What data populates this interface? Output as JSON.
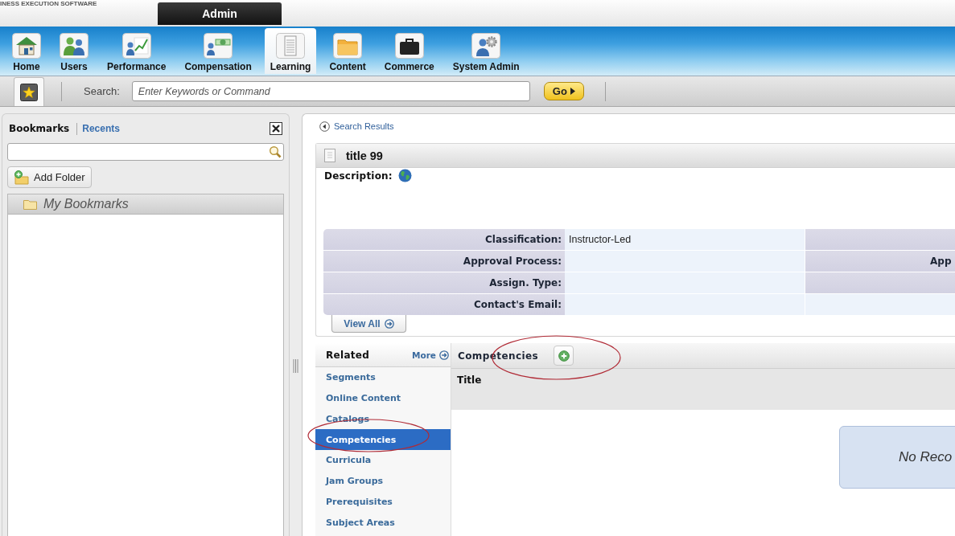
{
  "header": {
    "logo_text": "INESS EXECUTION SOFTWARE",
    "tabs": [
      {
        "label": "Admin",
        "selected": true
      }
    ]
  },
  "nav_bar": {
    "items": [
      {
        "label": "Home",
        "selected": false
      },
      {
        "label": "Users",
        "selected": false
      },
      {
        "label": "Performance",
        "selected": false
      },
      {
        "label": "Compensation",
        "selected": false
      },
      {
        "label": "Learning",
        "selected": true
      },
      {
        "label": "Content",
        "selected": false
      },
      {
        "label": "Commerce",
        "selected": false
      },
      {
        "label": "System Admin",
        "selected": false
      }
    ]
  },
  "search_bar": {
    "label": "Search:",
    "placeholder": "Enter Keywords or Command",
    "go_button": "Go"
  },
  "bookmarks_panel": {
    "tabs": [
      {
        "label": "Bookmarks",
        "selected": true
      },
      {
        "label": "Recents",
        "selected": false
      }
    ],
    "add_folder_button": "Add Folder",
    "tree": [
      {
        "label": "My Bookmarks"
      }
    ]
  },
  "record": {
    "back_link": "Search Results",
    "title": "title 99",
    "description_label": "Description:",
    "properties": [
      {
        "kind": "double",
        "label": "Classification:",
        "value": "Instructor-Led"
      },
      {
        "kind": "double",
        "label": "Approval Process:",
        "label_2": "App"
      },
      {
        "kind": "double",
        "label": "Assign. Type:"
      },
      {
        "kind": "single",
        "label": "Contact's Email:"
      }
    ],
    "view_all_button": "View All"
  },
  "related": {
    "title": "Related",
    "more_link": "More",
    "items": [
      {
        "label": "Segments",
        "selected": false,
        "circled": false
      },
      {
        "label": "Online Content",
        "selected": false,
        "circled": false
      },
      {
        "label": "Catalogs",
        "selected": false,
        "circled": false
      },
      {
        "label": "Competencies",
        "selected": true,
        "circled": true
      },
      {
        "label": "Curricula",
        "selected": false,
        "circled": false
      },
      {
        "label": "Jam Groups",
        "selected": false,
        "circled": false
      },
      {
        "label": "Prerequisites",
        "selected": false,
        "circled": false
      },
      {
        "label": "Subject Areas",
        "selected": false,
        "circled": false
      }
    ]
  },
  "competencies": {
    "title": "Competencies",
    "circled": true,
    "columns": [
      "Title"
    ],
    "empty_message": "No Reco"
  }
}
